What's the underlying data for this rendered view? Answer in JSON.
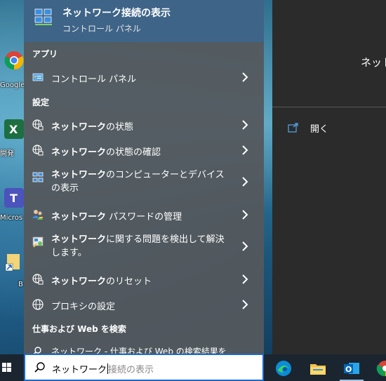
{
  "desktop": {
    "icons": [
      {
        "label": "Google",
        "icon": "chrome-icon"
      },
      {
        "label": "開発",
        "icon": "excel-icon"
      },
      {
        "label": "Micros",
        "icon": "teams-icon"
      },
      {
        "label": "B",
        "icon": "folder-shortcut-icon"
      }
    ]
  },
  "best_match": {
    "title": "ネットワーク接続の表示",
    "subtitle": "コントロール パネル",
    "icon": "network-connections-icon"
  },
  "sections": {
    "apps": "アプリ",
    "settings": "設定",
    "web": "仕事および Web を検索"
  },
  "apps": [
    {
      "label": "コントロール パネル",
      "icon": "control-panel-icon"
    }
  ],
  "settings": [
    {
      "bold": "ネットワーク",
      "rest": "の状態",
      "icon": "globe-network-icon"
    },
    {
      "bold": "ネットワーク",
      "rest": "の状態の確認",
      "icon": "globe-network-icon"
    },
    {
      "bold": "ネットワーク",
      "rest": "のコンピューターとデバイスの表示",
      "icon": "network-computers-icon"
    },
    {
      "bold": "ネットワーク",
      "rest": " パスワードの管理",
      "icon": "users-key-icon"
    },
    {
      "bold": "ネットワーク",
      "rest": "に関する問題を検出して解決します。",
      "icon": "troubleshoot-icon"
    },
    {
      "bold": "ネットワーク",
      "rest": "のリセット",
      "icon": "globe-network-icon"
    },
    {
      "bold": "",
      "rest": "プロキシの設定",
      "icon": "globe-icon"
    }
  ],
  "web_result": "ネットワーク - 仕事および Web の検索結果を",
  "detail": {
    "title": "ネット",
    "open_label": "開く"
  },
  "search": {
    "typed": "ネットワーク",
    "suggestion": "接続の表示"
  },
  "colors": {
    "highlight": "#3e6488",
    "accent": "#1b6ac9"
  }
}
